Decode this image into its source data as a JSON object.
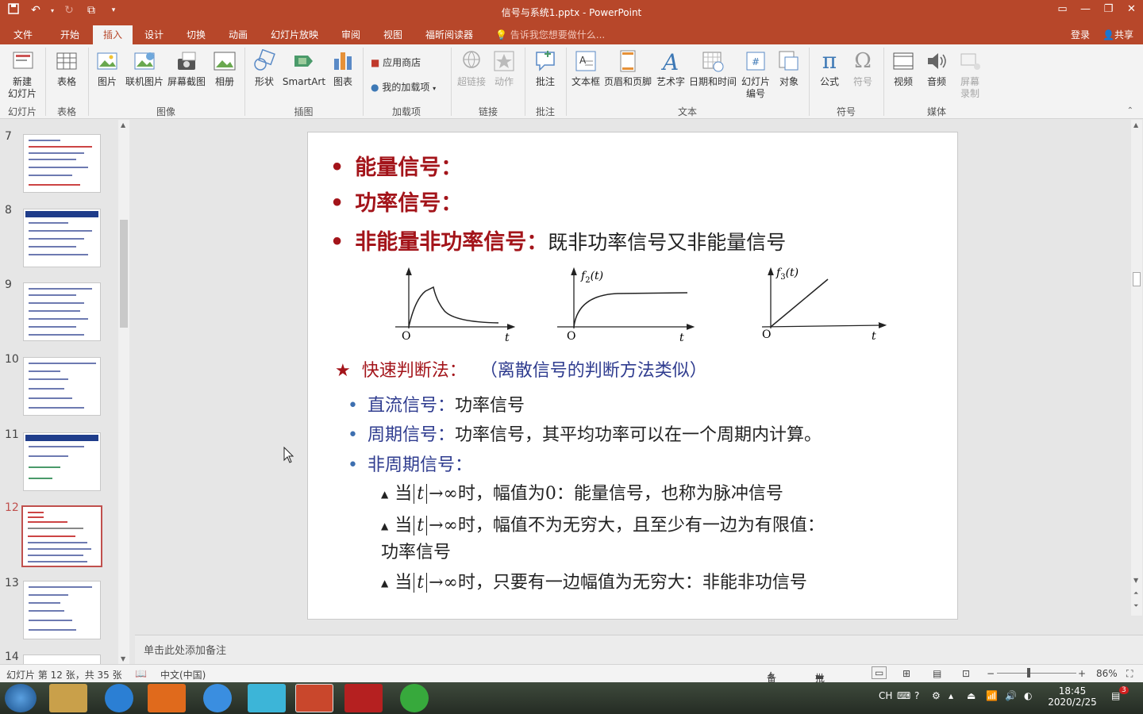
{
  "app": {
    "title": "信号与系统1.pptx - PowerPoint",
    "brand_color": "#b7472a"
  },
  "quick_access": {
    "icons": [
      "save-icon",
      "undo-icon",
      "redo-icon",
      "start-from-beginning-icon",
      "customize-qat-icon"
    ]
  },
  "window_controls": [
    "ribbon-display-icon",
    "minimize-icon",
    "restore-icon",
    "close-icon"
  ],
  "tabs": [
    {
      "label": "文件",
      "active": false
    },
    {
      "label": "开始",
      "active": false
    },
    {
      "label": "插入",
      "active": true
    },
    {
      "label": "设计",
      "active": false
    },
    {
      "label": "切换",
      "active": false
    },
    {
      "label": "动画",
      "active": false
    },
    {
      "label": "幻灯片放映",
      "active": false
    },
    {
      "label": "审阅",
      "active": false
    },
    {
      "label": "视图",
      "active": false
    },
    {
      "label": "福昕阅读器",
      "active": false
    }
  ],
  "tell_me": "告诉我您想要做什么...",
  "account": {
    "login": "登录",
    "share": "共享"
  },
  "ribbon": {
    "new_slide": "新建\n幻灯片",
    "table": "表格",
    "picture": "图片",
    "online_picture": "联机图片",
    "screenshot": "屏幕截图",
    "album": "相册",
    "shapes": "形状",
    "smartart": "SmartArt",
    "chart": "图表",
    "store": "应用商店",
    "my_addins": "我的加载项",
    "hyperlink": "超链接",
    "action": "动作",
    "comment": "批注",
    "textbox": "文本框",
    "header_footer": "页眉和页脚",
    "wordart": "艺术字",
    "datetime": "日期和时间",
    "slide_number": "幻灯片\n编号",
    "object": "对象",
    "equation": "公式",
    "symbol": "符号",
    "video": "视频",
    "audio": "音频",
    "screen_record": "屏幕\n录制",
    "groups": {
      "slides": "幻灯片",
      "tables": "表格",
      "images": "图像",
      "illustrations": "插图",
      "addins": "加载项",
      "links": "链接",
      "comments": "批注",
      "text": "文本",
      "symbols": "符号",
      "media": "媒体"
    }
  },
  "thumbnails": {
    "numbers": [
      "7",
      "8",
      "9",
      "10",
      "11",
      "12",
      "13",
      "14"
    ],
    "selected": "12"
  },
  "slide": {
    "bullet1": "能量信号：",
    "bullet2": "功率信号：",
    "bullet3_red": "非能量非功率信号：",
    "bullet3_plain": "既非功率信号又非能量信号",
    "graph_labels": {
      "origin": "O",
      "t": "t",
      "f2": "f",
      "f2_sub": "2",
      "f2_arg": "(t)",
      "f3": "f",
      "f3_sub": "3",
      "f3_arg": "(t)"
    },
    "quick_title": "快速判断法：",
    "quick_note": "（离散信号的判断方法类似）",
    "dc_label": "直流信号：",
    "dc_text": "功率信号",
    "periodic_label": "周期信号：",
    "periodic_text": "功率信号，其平均功率可以在一个周期内计算。",
    "aperiodic_label": "非周期信号：",
    "when": "当",
    "t_var": "t",
    "arrow_inf": "→∞时，",
    "case1": "幅值为0：能量信号，也称为脉冲信号",
    "case2_line1": "幅值不为无穷大，且至少有一边为有限值：",
    "case2_line2": "功率信号",
    "case3": "只要有一边幅值为无穷大：非能非功信号"
  },
  "notes_placeholder": "单击此处添加备注",
  "status": {
    "slide_info": "幻灯片 第 12 张，共 35 张",
    "language": "中文(中国)",
    "notes": "备注",
    "comments": "批注",
    "zoom": "86%"
  },
  "taskbar": {
    "tray_lang": "CH",
    "time": "18:45",
    "date": "2020/2/25",
    "badge": "3",
    "apps": [
      "windows-start-icon",
      "file-explorer-icon",
      "k-app-icon",
      "pdf-reader-icon",
      "sogou-icon",
      "qq-contacts-icon",
      "powerpoint-icon",
      "red-app-icon",
      "wechat-icon"
    ]
  }
}
